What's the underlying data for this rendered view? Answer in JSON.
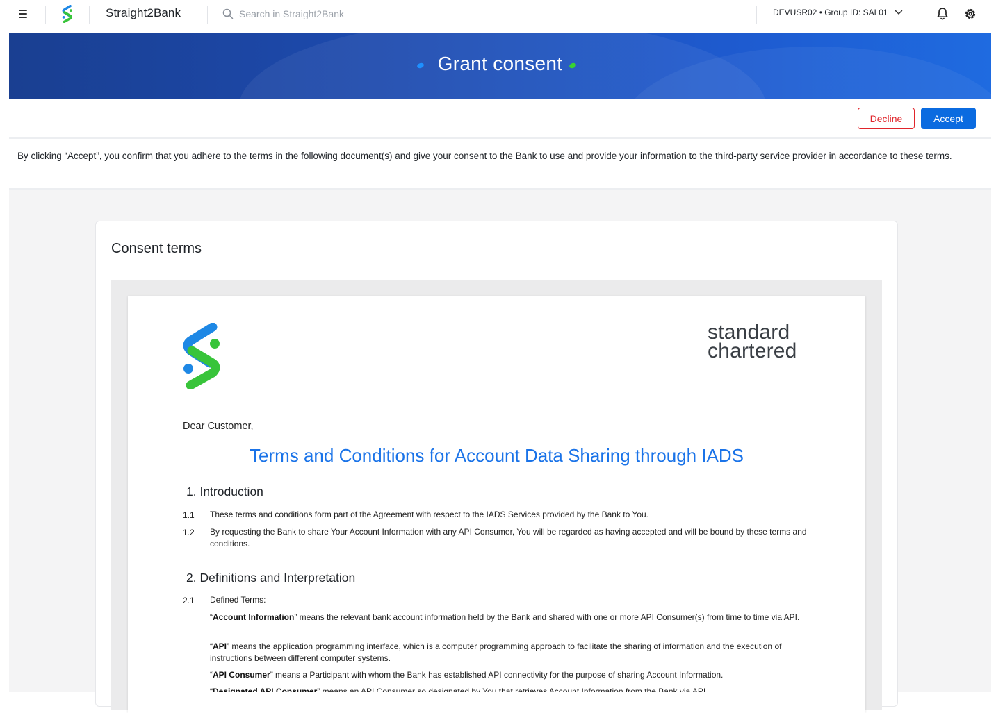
{
  "topbar": {
    "app_title": "Straight2Bank",
    "search_placeholder": "Search in Straight2Bank",
    "user_label": "DEVUSR02 • Group ID: SAL01"
  },
  "banner": {
    "title": "Grant consent"
  },
  "actions": {
    "decline_label": "Decline",
    "accept_label": "Accept"
  },
  "consent_note": "By clicking “Accept”, you confirm that you adhere to the terms in the following document(s) and give your consent to the Bank to use and provide your information to the third-party service provider in accordance to these terms.",
  "card": {
    "title": "Consent terms"
  },
  "document": {
    "brand_line1": "standard",
    "brand_line2": "chartered",
    "greeting": "Dear Customer,",
    "title": "Terms and Conditions for Account Data Sharing through IADS",
    "section1": {
      "heading": "1. Introduction",
      "items": [
        {
          "num": "1.1",
          "text": "These terms and conditions form part of the Agreement with respect to the IADS Services provided by the Bank to You."
        },
        {
          "num": "1.2",
          "text": "By requesting the Bank to share Your Account Information with any API Consumer, You will be regarded as having accepted and will be bound by these terms and conditions."
        }
      ]
    },
    "section2": {
      "heading": "2. Definitions and Interpretation",
      "item_num": "2.1",
      "item_text": "Defined Terms:",
      "definitions": [
        {
          "term": "Account Information",
          "text": " means the relevant bank account information held by the Bank and shared with one or more API Consumer(s) from time to time via API."
        },
        {
          "term": "API",
          "text": " means the application programming interface, which is a computer programming approach to facilitate the sharing of information and the execution of instructions between different computer systems."
        },
        {
          "term": "API Consumer",
          "text": " means a Participant with whom the Bank has established API connectivity for the purpose of sharing Account Information."
        },
        {
          "term": "Designated API Consumer",
          "text": " means an API Consumer so designated by You that retrieves Account Information from the Bank via API."
        }
      ]
    }
  },
  "colors": {
    "banner": "#1d4bb0",
    "accept": "#0b6be0",
    "decline": "#e0252b",
    "doc_title": "#1a73e8",
    "logo_blue": "#1e88e5",
    "logo_green": "#38c43a"
  }
}
